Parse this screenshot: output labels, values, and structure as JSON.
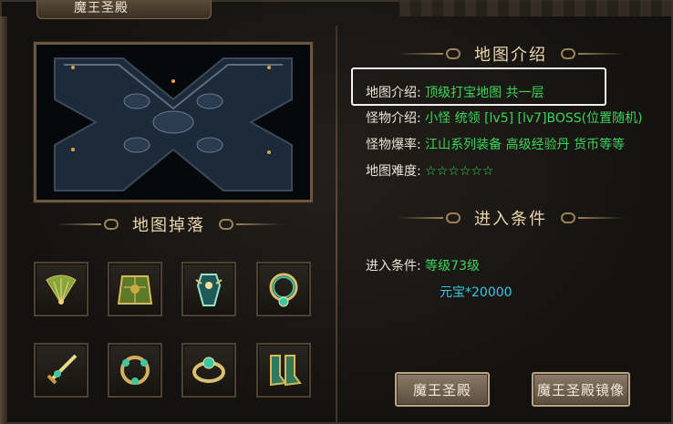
{
  "window": {
    "title": "魔王圣殿"
  },
  "map_drops": {
    "heading": "地图掉落"
  },
  "map_info": {
    "heading": "地图介绍",
    "rows": [
      {
        "label": "地图介绍:",
        "value": "顶级打宝地图 共一层"
      },
      {
        "label": "怪物介绍:",
        "value": "小怪 统领 [lv5] [lv7]BOSS(位置随机)"
      },
      {
        "label": "怪物爆率:",
        "value": "江山系列装备 高级经验丹 货币等等"
      },
      {
        "label": "地图难度:",
        "value": "☆☆☆☆☆☆"
      }
    ]
  },
  "entry": {
    "heading": "进入条件",
    "label": "进入条件:",
    "level": "等级73级",
    "yuanbao": "元宝*20000"
  },
  "buttons": {
    "enter": "魔王圣殿",
    "mirror": "魔王圣殿镜像"
  },
  "drop_items": [
    {
      "icon": "gold-fan-icon"
    },
    {
      "icon": "jade-armor-icon"
    },
    {
      "icon": "cyan-armor-icon"
    },
    {
      "icon": "jade-necklace-icon"
    },
    {
      "icon": "gold-sword-icon"
    },
    {
      "icon": "jade-bracelet-icon"
    },
    {
      "icon": "gold-ring-icon"
    },
    {
      "icon": "jade-boots-icon"
    }
  ],
  "colors": {
    "value_green": "#3dd65a",
    "heading_gold": "#ecd7ad"
  }
}
